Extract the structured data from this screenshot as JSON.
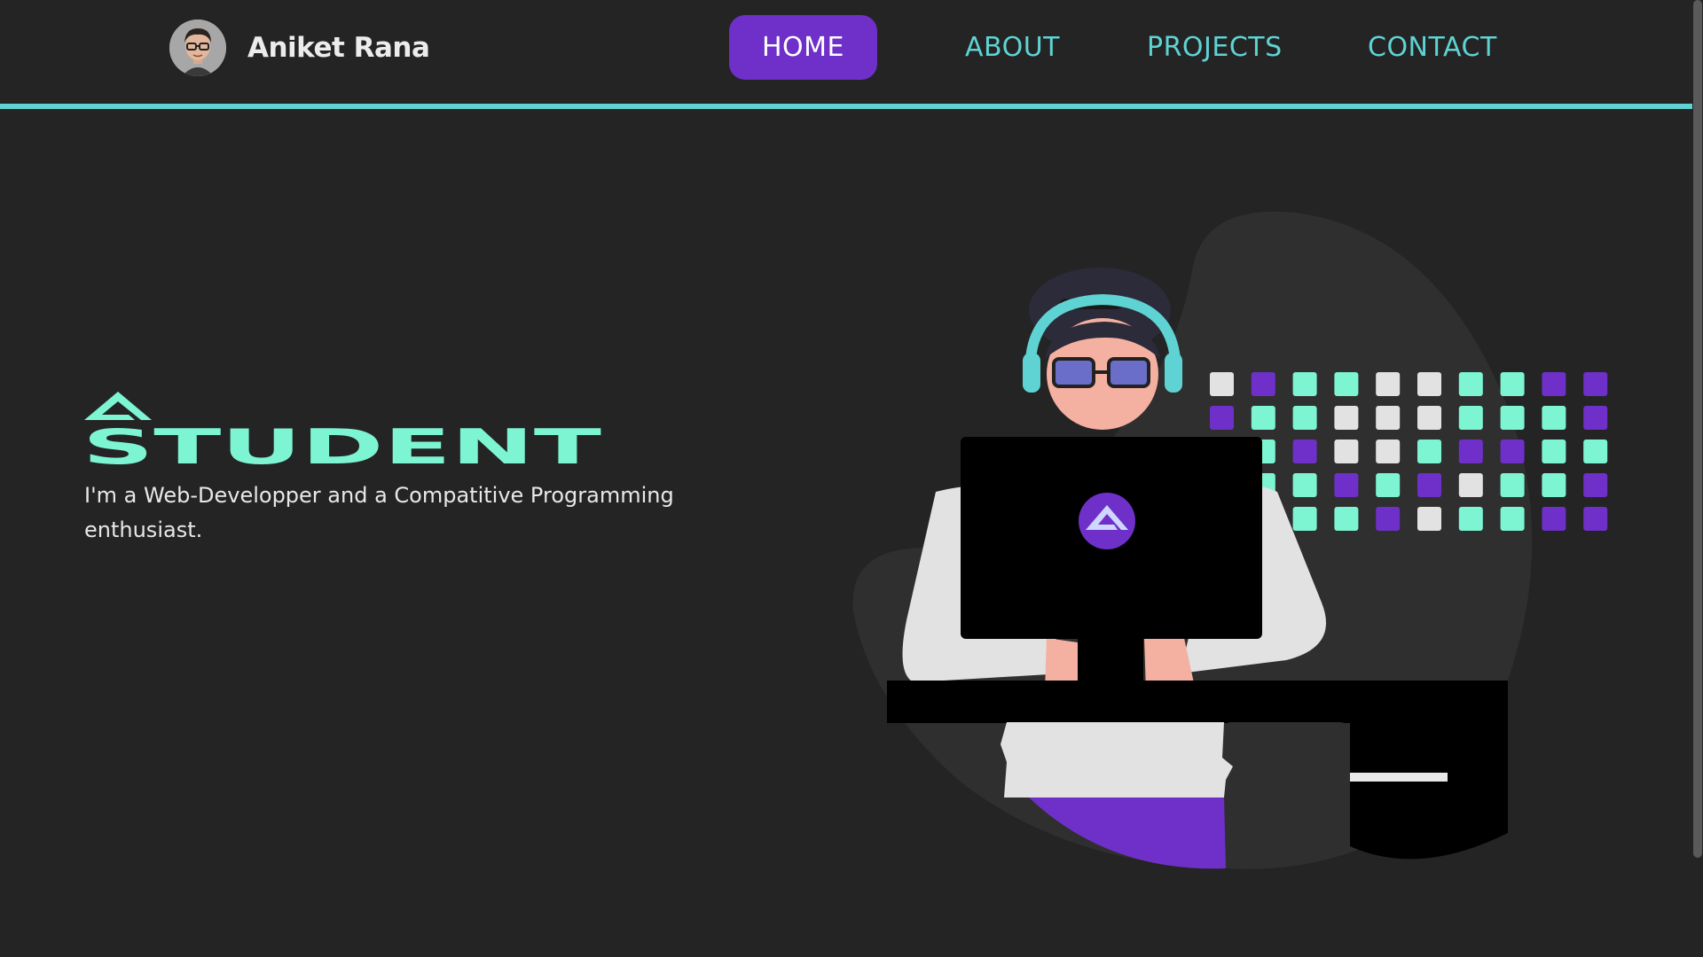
{
  "brand": {
    "name": "Aniket Rana"
  },
  "nav": {
    "items": [
      {
        "label": "HOME",
        "active": true
      },
      {
        "label": "ABOUT",
        "active": false
      },
      {
        "label": "PROJECTS",
        "active": false
      },
      {
        "label": "CONTACT",
        "active": false
      }
    ]
  },
  "hero": {
    "title": "STUDENT",
    "subtitle": "I'm a Web-Developper and a Compatitive Programming enthusiast."
  },
  "colors": {
    "background": "#242424",
    "accent_teal": "#5fd3d3",
    "accent_mint": "#7df5d2",
    "accent_purple": "#6e30c8"
  },
  "icons": [
    "avatar-image",
    "roof-logo-icon",
    "developer-illustration",
    "laptop-logo-icon"
  ]
}
